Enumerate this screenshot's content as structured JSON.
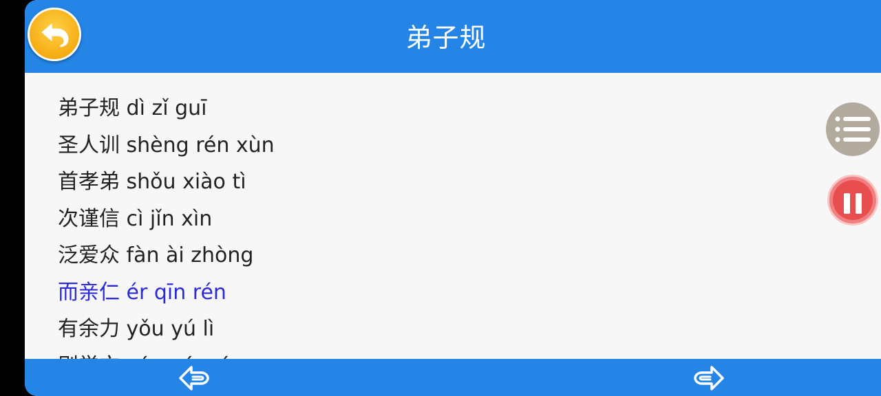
{
  "header": {
    "title": "弟子规"
  },
  "content": {
    "lines": [
      {
        "text": "弟子规 dì zǐ guī",
        "active": false
      },
      {
        "text": "圣人训 shèng rén xùn",
        "active": false
      },
      {
        "text": "首孝弟 shǒu xiào tì",
        "active": false
      },
      {
        "text": "次谨信 cì jǐn xìn",
        "active": false
      },
      {
        "text": "泛爱众 fàn ài zhòng",
        "active": false
      },
      {
        "text": "而亲仁 ér qīn rén",
        "active": true
      },
      {
        "text": "有余力 yǒu yú lì",
        "active": false
      },
      {
        "text": "则学文 zé xué wén",
        "active": false
      }
    ]
  },
  "icons": {
    "back": "back-arrow-icon",
    "menu": "list-menu-icon",
    "pause": "pause-icon",
    "prev": "prev-arrow-icon",
    "next": "next-arrow-icon"
  },
  "colors": {
    "bar": "#2485e6",
    "active_text": "#2a2ad8",
    "back_button": "#f5a90f",
    "pause_button": "#e84e4e",
    "menu_button": "#b2aa9d"
  }
}
